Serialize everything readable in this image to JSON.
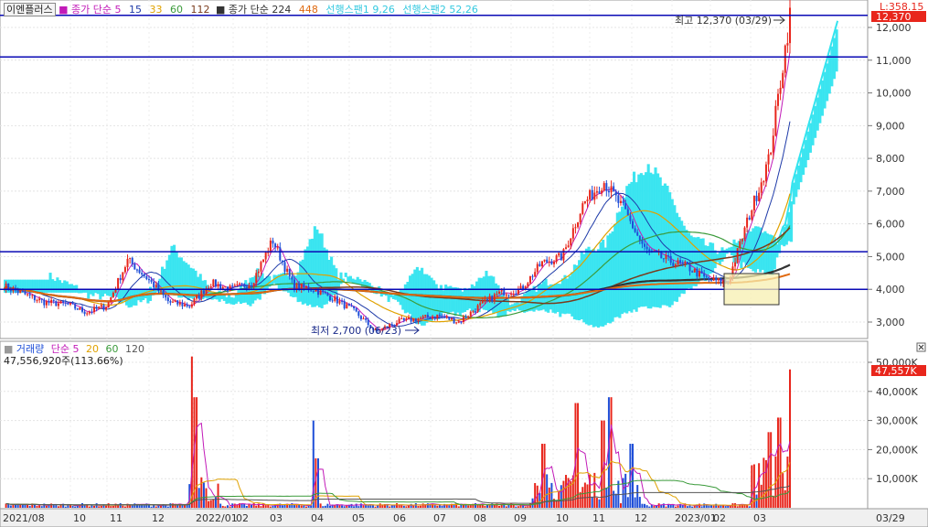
{
  "window": {
    "stock_name": "이엔플러스",
    "price_ma_label": "종가 단순",
    "price_ma_periods": [
      "5",
      "15",
      "33",
      "60",
      "112"
    ],
    "price_ma_label_2": "종가 단순",
    "price_ma_periods_2": [
      "224",
      "448"
    ],
    "span1_label": "선행스팬1",
    "span1_params": "9,26",
    "span2_label": "선행스팬2",
    "span2_params": "52,26",
    "corner_label": "L:358.15",
    "last_price_badge": "12,370",
    "high_annotation": "최고 12,370 (03/29)",
    "low_annotation": "최저 2,700 (06/23)",
    "volume_title": "거래량",
    "volume_ma_label": "단순",
    "volume_ma_periods": [
      "5",
      "20",
      "60",
      "120"
    ],
    "volume_value": "47,556,920주(113.66%)",
    "last_volume_badge": "47,557K",
    "volume_close_icon": "close-x-icon"
  },
  "colors": {
    "up_candle": "#e8261c",
    "down_candle": "#1f4fd8",
    "cloud": "#33e4ef",
    "hline": "#0a0ab5",
    "ma5": "#c21bb8",
    "ma15": "#1e3aa8",
    "ma33": "#e0a200",
    "ma60": "#3b9b3b",
    "ma112": "#7a3b1c",
    "ma224": "#333333",
    "ma448": "#e06a10",
    "annotation_box": "#f7efb0"
  },
  "chart_data": [
    {
      "type": "candlestick",
      "name": "price",
      "y_ticks": [
        "12,000",
        "11,000",
        "10,000",
        "9,000",
        "8,000",
        "7,000",
        "6,000",
        "5,000",
        "4,000",
        "3,000"
      ],
      "y_tick_values": [
        12000,
        11000,
        10000,
        9000,
        8000,
        7000,
        6000,
        5000,
        4000,
        3000
      ],
      "ylim": [
        2500,
        12600
      ],
      "horizontal_lines": [
        12370,
        11100,
        5150,
        4000
      ],
      "x_labels": [
        "2021/08",
        "10",
        "11",
        "12",
        "2022/01",
        "02",
        "03",
        "04",
        "05",
        "06",
        "07",
        "08",
        "09",
        "10",
        "11",
        "12",
        "2023/01",
        "02",
        "03",
        "03/29"
      ],
      "close_series": [
        [
          "2021/08",
          4100
        ],
        [
          "2021/09",
          3850
        ],
        [
          "2021/10",
          3600
        ],
        [
          "2021/11",
          3550
        ],
        [
          "2021/12",
          3300
        ],
        [
          "2021/12",
          3500
        ],
        [
          "2022/01",
          4900
        ],
        [
          "2022/01",
          4300
        ],
        [
          "2022/02",
          3600
        ],
        [
          "2022/02",
          3500
        ],
        [
          "2022/03",
          4200
        ],
        [
          "2022/03",
          4000
        ],
        [
          "2022/04",
          4200
        ],
        [
          "2022/04",
          5500
        ],
        [
          "2022/04",
          4100
        ],
        [
          "2022/05",
          4000
        ],
        [
          "2022/05",
          3700
        ],
        [
          "2022/06",
          3300
        ],
        [
          "2022/06",
          2700
        ],
        [
          "2022/07",
          3000
        ],
        [
          "2022/07",
          3100
        ],
        [
          "2022/08",
          3200
        ],
        [
          "2022/08",
          3000
        ],
        [
          "2022/09",
          3500
        ],
        [
          "2022/09",
          3900
        ],
        [
          "2022/10",
          4000
        ],
        [
          "2022/10",
          4800
        ],
        [
          "2022/11",
          5000
        ],
        [
          "2022/11",
          6600
        ],
        [
          "2022/12",
          7300
        ],
        [
          "2022/12",
          6400
        ],
        [
          "2023/01",
          5200
        ],
        [
          "2023/01",
          4900
        ],
        [
          "2023/02",
          4700
        ],
        [
          "2023/02",
          4300
        ],
        [
          "2023/03",
          4200
        ],
        [
          "2023/03",
          6200
        ],
        [
          "2023/03",
          8000
        ],
        [
          "2023/03",
          12370
        ]
      ],
      "high": {
        "value": 12370,
        "date": "03/29"
      },
      "low": {
        "value": 2700,
        "date": "06/23"
      }
    },
    {
      "type": "bar",
      "name": "volume",
      "y_ticks": [
        "50,000K",
        "40,000K",
        "30,000K",
        "20,000K",
        "10,000K"
      ],
      "y_tick_values": [
        50000,
        40000,
        30000,
        20000,
        10000
      ],
      "ylim": [
        0,
        55000
      ],
      "last_value": 47557,
      "spikes": [
        [
          "2022/01",
          52000
        ],
        [
          "2022/01",
          38000
        ],
        [
          "2022/04",
          30000
        ],
        [
          "2022/04",
          17000
        ],
        [
          "2022/09",
          22000
        ],
        [
          "2022/10",
          36000
        ],
        [
          "2022/11",
          30000
        ],
        [
          "2022/11",
          38000
        ],
        [
          "2022/12",
          22000
        ],
        [
          "2023/03",
          26000
        ],
        [
          "2023/03",
          31000
        ],
        [
          "2023/03",
          47557
        ]
      ]
    }
  ]
}
